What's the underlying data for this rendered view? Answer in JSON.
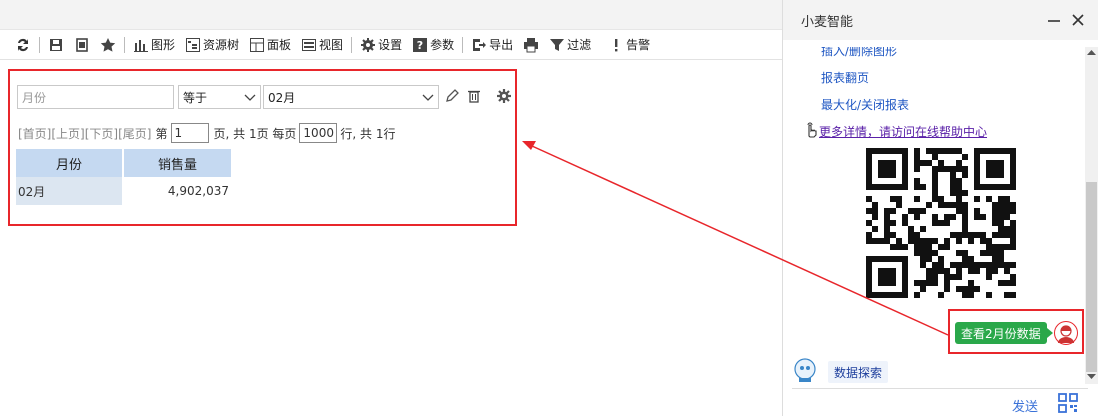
{
  "colors": {
    "accent_red": "#e8262b",
    "header_blue": "#c5d9f1",
    "link_blue": "#1f57c3",
    "bubble_green": "#2aa84a"
  },
  "toolbar": {
    "items": [
      {
        "icon": "refresh-icon",
        "label": ""
      },
      {
        "icon": "save-icon",
        "label": ""
      },
      {
        "icon": "save-as-icon",
        "label": ""
      },
      {
        "icon": "star-icon",
        "label": ""
      },
      {
        "icon": "chart-icon",
        "label": "图形"
      },
      {
        "icon": "resource-tree-icon",
        "label": "资源树"
      },
      {
        "icon": "panel-icon",
        "label": "面板"
      },
      {
        "icon": "view-icon",
        "label": "视图"
      },
      {
        "icon": "gear-icon",
        "label": "设置"
      },
      {
        "icon": "param-icon",
        "label": "参数"
      },
      {
        "icon": "export-icon",
        "label": "导出"
      },
      {
        "icon": "print-icon",
        "label": ""
      },
      {
        "icon": "filter-icon",
        "label": "过滤"
      },
      {
        "icon": "alert-icon",
        "label": "告警"
      }
    ]
  },
  "filter": {
    "field_placeholder": "月份",
    "operator": "等于",
    "value": "02月"
  },
  "pager": {
    "first": "[首页]",
    "prev": "[上页]",
    "next": "[下页]",
    "last": "[尾页]",
    "page_prefix": "第",
    "page": "1",
    "page_suffix": "页, 共 1页 每页",
    "page_size": "1000",
    "rows_suffix": "行, 共 1行"
  },
  "table": {
    "headers": [
      "月份",
      "销售量"
    ],
    "rows": [
      [
        "02月",
        "4,902,037"
      ]
    ]
  },
  "assistant": {
    "title": "小麦智能",
    "truncated_link": "插入/删除图形",
    "links": [
      "报表翻页",
      "最大化/关闭报表"
    ],
    "more_link": "更多详情，请访问在线帮助中心",
    "user_message": "查看2月份数据",
    "bot_chip": "数据探索",
    "send": "发送"
  }
}
